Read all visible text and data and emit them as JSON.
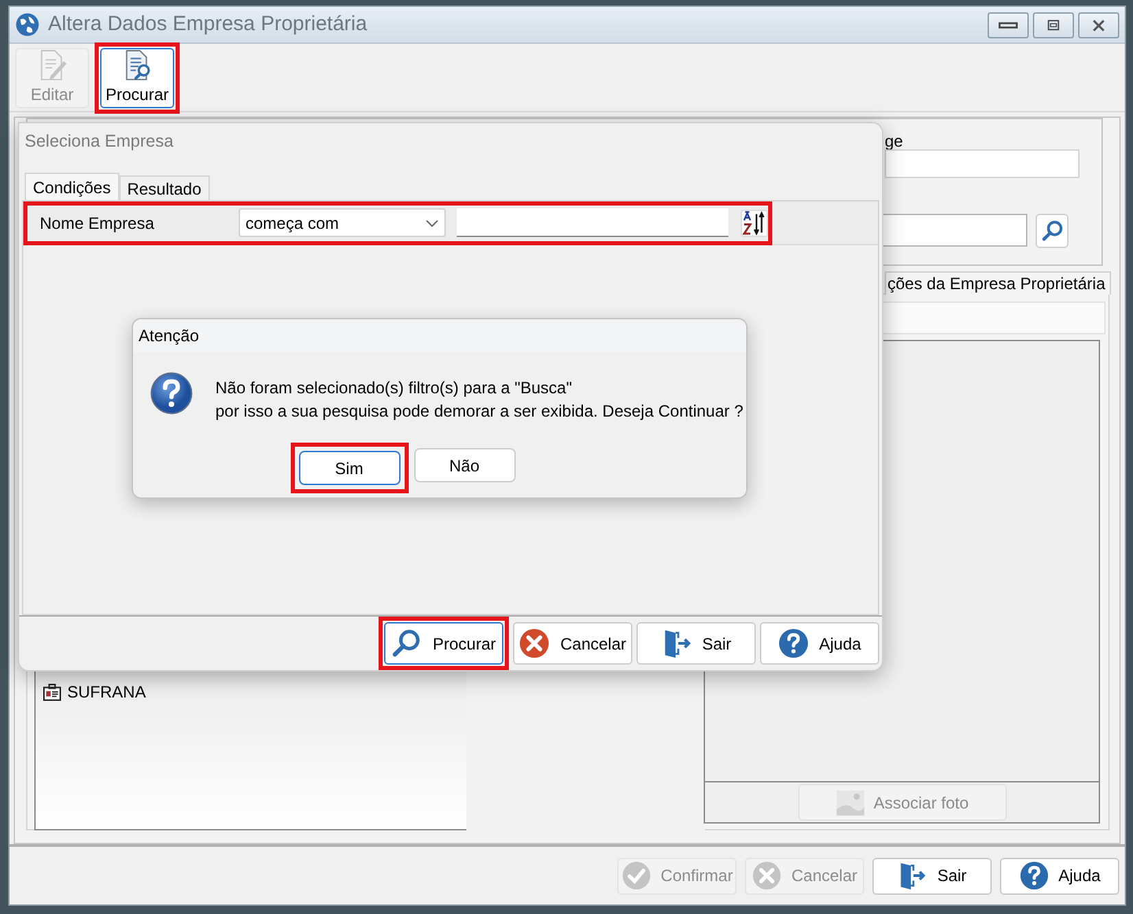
{
  "window": {
    "title": "Altera Dados Empresa Proprietária"
  },
  "toolbar": [
    {
      "kind": "edit",
      "label": "Editar",
      "disabled": true,
      "highlighted": false
    },
    {
      "kind": "search",
      "label": "Procurar",
      "disabled": false,
      "highlighted": true
    }
  ],
  "background": {
    "field_label": "ge",
    "tab": "ções da Empresa Proprietária",
    "list_items": [
      {
        "label": "SUFRANA"
      }
    ],
    "photo_button": {
      "label": "Associar foto",
      "disabled": true
    }
  },
  "search_dialog": {
    "title": "Seleciona Empresa",
    "tabs": [
      {
        "label": "Condições",
        "selected": true
      },
      {
        "label": "Resultado",
        "selected": false
      }
    ],
    "filter": {
      "label": "Nome Empresa",
      "operator": "começa com",
      "highlighted": true
    },
    "buttons": [
      {
        "kind": "search",
        "label": "Procurar",
        "focused": true,
        "highlighted": true
      },
      {
        "kind": "cancel",
        "label": "Cancelar",
        "focused": false,
        "highlighted": false
      },
      {
        "kind": "exit",
        "label": "Sair",
        "focused": false,
        "highlighted": false
      },
      {
        "kind": "help",
        "label": "Ajuda",
        "focused": false,
        "highlighted": false
      }
    ]
  },
  "alert": {
    "title": "Atenção",
    "message_lines": [
      "Não foram selecionado(s) filtro(s) para a \"Busca\"",
      "por isso a sua pesquisa pode demorar a ser exibida. Deseja Continuar ?"
    ],
    "buttons": [
      {
        "label": "Sim",
        "focused": true,
        "highlighted": true
      },
      {
        "label": "Não",
        "focused": false,
        "highlighted": false
      }
    ]
  },
  "footer_buttons": [
    {
      "kind": "confirm",
      "label": "Confirmar",
      "disabled": true
    },
    {
      "kind": "cancel",
      "label": "Cancelar",
      "disabled": true
    },
    {
      "kind": "exit",
      "label": "Sair",
      "disabled": false
    },
    {
      "kind": "help",
      "label": "Ajuda",
      "disabled": false
    }
  ]
}
